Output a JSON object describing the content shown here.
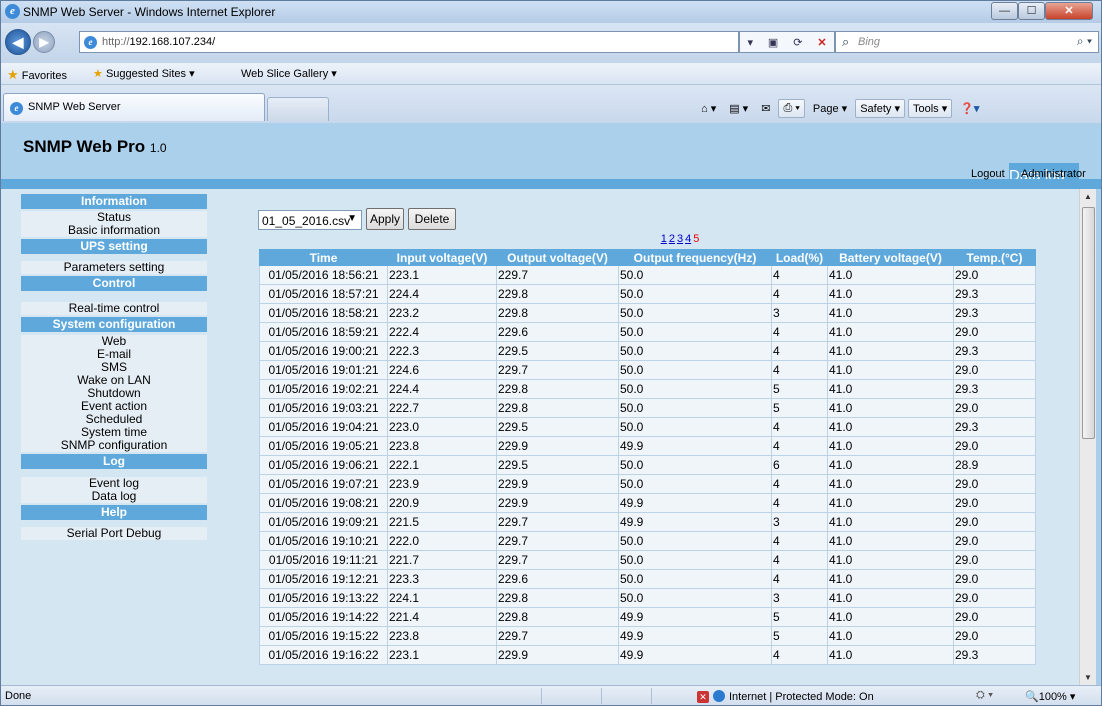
{
  "browser": {
    "window_title": "SNMP Web Server - Windows Internet Explorer",
    "url_prefix": "http://",
    "url_host": "192.168.107.234/",
    "search_placeholder": "Bing",
    "favorites_label": "Favorites",
    "suggested_sites": "Suggested Sites ▾",
    "web_slice": "Web Slice Gallery ▾",
    "tab_title": "SNMP Web Server",
    "cmd_page": "Page ▾",
    "cmd_safety": "Safety ▾",
    "cmd_tools": "Tools ▾",
    "status_text": "Done",
    "zone_text": "Internet | Protected Mode: On",
    "zoom_text": "100%"
  },
  "app": {
    "title": "SNMP Web Pro",
    "version": "1.0",
    "page_heading": "Data log",
    "logout": "Logout",
    "user": "Administrator"
  },
  "sidebar": {
    "sections": [
      {
        "label": "Information",
        "items": [
          "Status",
          "Basic information"
        ]
      },
      {
        "label": "UPS setting",
        "items": [
          "Parameters setting"
        ]
      },
      {
        "label": "Control",
        "items": [
          "Real-time control"
        ]
      },
      {
        "label": "System configuration",
        "items": [
          "Web",
          "E-mail",
          "SMS",
          "Wake on LAN",
          "Shutdown",
          "Event action",
          "Scheduled",
          "System time",
          "SNMP configuration"
        ]
      },
      {
        "label": "Log",
        "items": [
          "Event log",
          "Data log"
        ]
      },
      {
        "label": "Help",
        "items": [
          "Serial Port Debug"
        ]
      }
    ]
  },
  "datalog": {
    "selected_file": "01_05_2016.csv",
    "apply_label": "Apply",
    "delete_label": "Delete",
    "pages": [
      "1",
      "2",
      "3",
      "4",
      "5"
    ],
    "current_page": "5",
    "columns": [
      "Time",
      "Input voltage(V)",
      "Output voltage(V)",
      "Output frequency(Hz)",
      "Load(%)",
      "Battery voltage(V)",
      "Temp.(°C)"
    ],
    "rows": [
      [
        "01/05/2016 18:56:21",
        "223.1",
        "229.7",
        "50.0",
        "4",
        "41.0",
        "29.0"
      ],
      [
        "01/05/2016 18:57:21",
        "224.4",
        "229.8",
        "50.0",
        "4",
        "41.0",
        "29.3"
      ],
      [
        "01/05/2016 18:58:21",
        "223.2",
        "229.8",
        "50.0",
        "3",
        "41.0",
        "29.3"
      ],
      [
        "01/05/2016 18:59:21",
        "222.4",
        "229.6",
        "50.0",
        "4",
        "41.0",
        "29.0"
      ],
      [
        "01/05/2016 19:00:21",
        "222.3",
        "229.5",
        "50.0",
        "4",
        "41.0",
        "29.3"
      ],
      [
        "01/05/2016 19:01:21",
        "224.6",
        "229.7",
        "50.0",
        "4",
        "41.0",
        "29.0"
      ],
      [
        "01/05/2016 19:02:21",
        "224.4",
        "229.8",
        "50.0",
        "5",
        "41.0",
        "29.3"
      ],
      [
        "01/05/2016 19:03:21",
        "222.7",
        "229.8",
        "50.0",
        "5",
        "41.0",
        "29.0"
      ],
      [
        "01/05/2016 19:04:21",
        "223.0",
        "229.5",
        "50.0",
        "4",
        "41.0",
        "29.3"
      ],
      [
        "01/05/2016 19:05:21",
        "223.8",
        "229.9",
        "49.9",
        "4",
        "41.0",
        "29.0"
      ],
      [
        "01/05/2016 19:06:21",
        "222.1",
        "229.5",
        "50.0",
        "6",
        "41.0",
        "28.9"
      ],
      [
        "01/05/2016 19:07:21",
        "223.9",
        "229.9",
        "50.0",
        "4",
        "41.0",
        "29.0"
      ],
      [
        "01/05/2016 19:08:21",
        "220.9",
        "229.9",
        "49.9",
        "4",
        "41.0",
        "29.0"
      ],
      [
        "01/05/2016 19:09:21",
        "221.5",
        "229.7",
        "49.9",
        "3",
        "41.0",
        "29.0"
      ],
      [
        "01/05/2016 19:10:21",
        "222.0",
        "229.7",
        "50.0",
        "4",
        "41.0",
        "29.0"
      ],
      [
        "01/05/2016 19:11:21",
        "221.7",
        "229.7",
        "50.0",
        "4",
        "41.0",
        "29.0"
      ],
      [
        "01/05/2016 19:12:21",
        "223.3",
        "229.6",
        "50.0",
        "4",
        "41.0",
        "29.0"
      ],
      [
        "01/05/2016 19:13:22",
        "224.1",
        "229.8",
        "50.0",
        "3",
        "41.0",
        "29.0"
      ],
      [
        "01/05/2016 19:14:22",
        "221.4",
        "229.8",
        "49.9",
        "5",
        "41.0",
        "29.0"
      ],
      [
        "01/05/2016 19:15:22",
        "223.8",
        "229.7",
        "49.9",
        "5",
        "41.0",
        "29.0"
      ],
      [
        "01/05/2016 19:16:22",
        "223.1",
        "229.9",
        "49.9",
        "4",
        "41.0",
        "29.3"
      ]
    ]
  },
  "colors": {
    "accent": "#5ea8dc",
    "header_bg": "#abd0ec",
    "panel_bg": "#d5e6f3",
    "current_page": "#ee0000"
  }
}
